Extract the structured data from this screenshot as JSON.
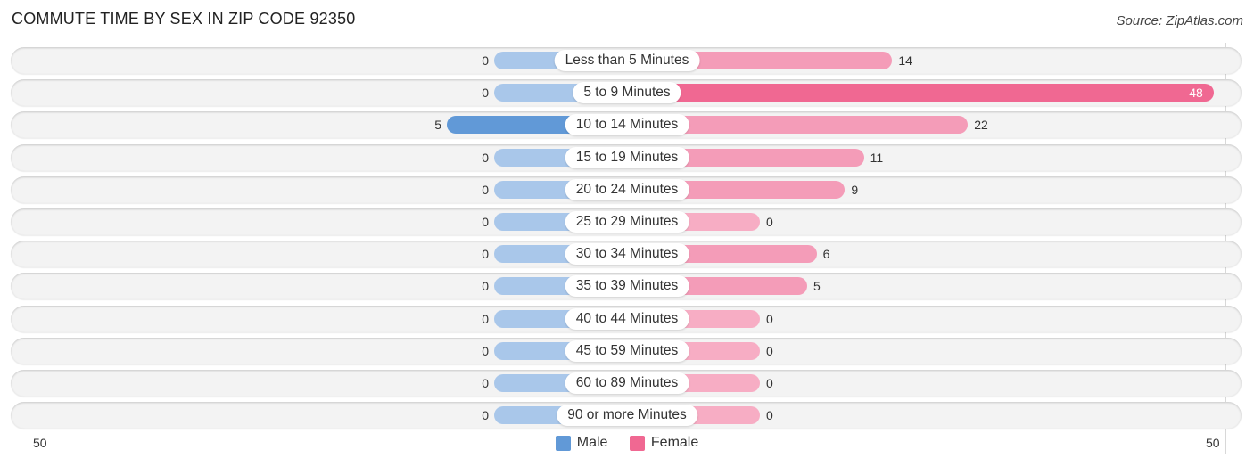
{
  "title": "COMMUTE TIME BY SEX IN ZIP CODE 92350",
  "source": "Source: ZipAtlas.com",
  "colors": {
    "male": "#a9c7ea",
    "male_strong": "#6199d7",
    "female": "#f49cb8",
    "female_strong": "#f06892",
    "legend_male": "#6199d7",
    "legend_female": "#f06892"
  },
  "legend": {
    "male": "Male",
    "female": "Female"
  },
  "axis": {
    "left_tick": "50",
    "right_tick": "50"
  },
  "chart_data": {
    "type": "bar",
    "orientation": "horizontal-diverging",
    "title": "COMMUTE TIME BY SEX IN ZIP CODE 92350",
    "xlabel": "",
    "ylabel": "",
    "xlim": [
      -50,
      50
    ],
    "legend_position": "bottom-center",
    "categories": [
      "Less than 5 Minutes",
      "5 to 9 Minutes",
      "10 to 14 Minutes",
      "15 to 19 Minutes",
      "20 to 24 Minutes",
      "25 to 29 Minutes",
      "30 to 34 Minutes",
      "35 to 39 Minutes",
      "40 to 44 Minutes",
      "45 to 59 Minutes",
      "60 to 89 Minutes",
      "90 or more Minutes"
    ],
    "series": [
      {
        "name": "Male",
        "values": [
          0,
          0,
          5,
          0,
          0,
          0,
          0,
          0,
          0,
          0,
          0,
          0
        ]
      },
      {
        "name": "Female",
        "values": [
          14,
          48,
          22,
          11,
          9,
          0,
          6,
          5,
          0,
          0,
          0,
          0
        ]
      }
    ]
  }
}
